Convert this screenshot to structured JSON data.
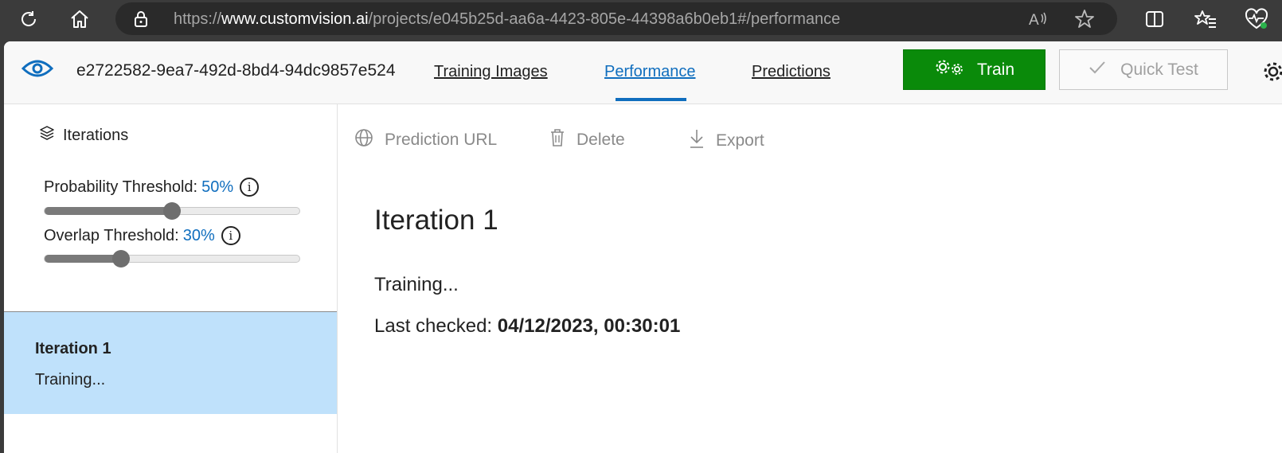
{
  "browser": {
    "url_prefix": "https://",
    "url_host": "www.customvision.ai",
    "url_path": "/projects/e045b25d-aa6a-4423-805e-44398a6b0eb1#/performance"
  },
  "header": {
    "project_id": "e2722582-9ea7-492d-8bd4-94dc9857e524",
    "tabs": [
      {
        "label": "Training Images",
        "active": false
      },
      {
        "label": "Performance",
        "active": true
      },
      {
        "label": "Predictions",
        "active": false
      }
    ],
    "train_label": "Train",
    "quick_test_label": "Quick Test"
  },
  "sidebar": {
    "title": "Iterations",
    "probability_label": "Probability Threshold:",
    "probability_value": "50%",
    "probability_level": 0.5,
    "overlap_label": "Overlap Threshold:",
    "overlap_value": "30%",
    "overlap_level": 0.3,
    "info_glyph": "i",
    "iterations": [
      {
        "name": "Iteration 1",
        "status": "Training..."
      }
    ]
  },
  "toolbar": {
    "prediction_url": "Prediction URL",
    "delete": "Delete",
    "export": "Export"
  },
  "main": {
    "title": "Iteration 1",
    "status": "Training...",
    "last_checked_label": "Last checked:",
    "last_checked_value": "04/12/2023, 00:30:01"
  },
  "colors": {
    "accent": "#106ebe",
    "train_button": "#0a8a0a",
    "selected_item": "#bfe1fb"
  }
}
